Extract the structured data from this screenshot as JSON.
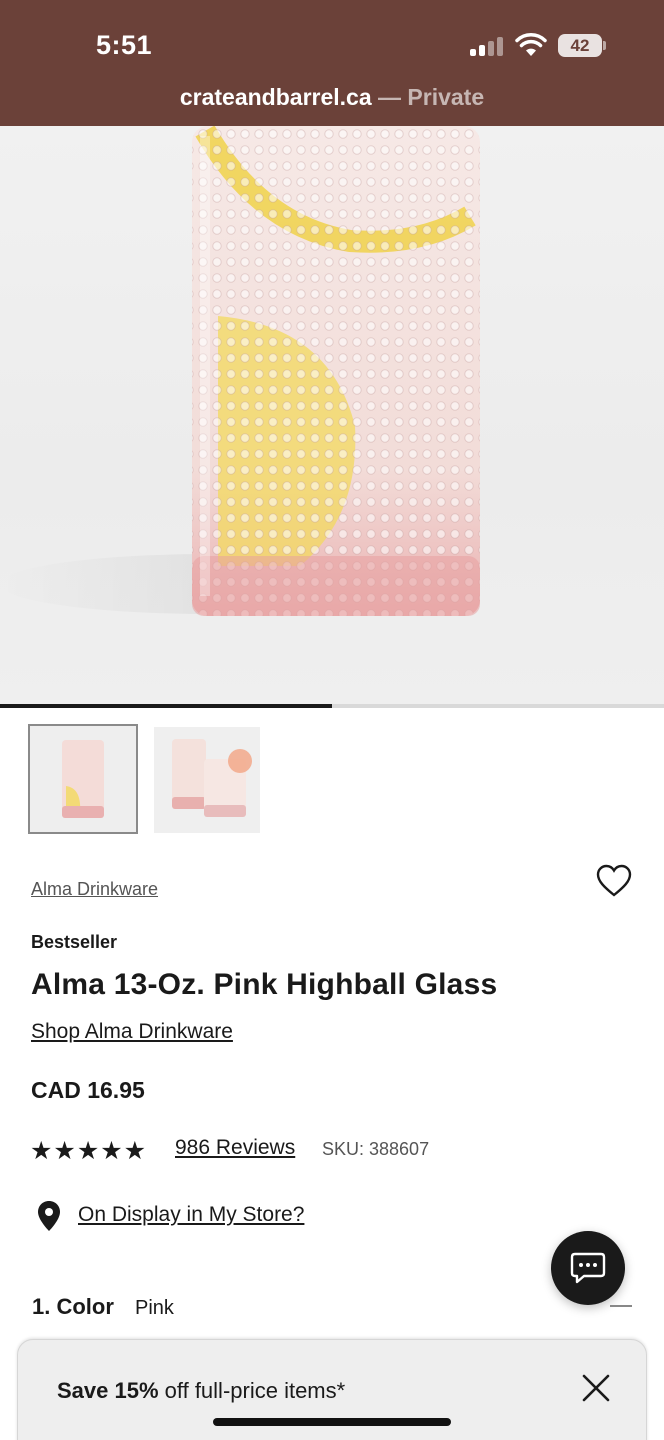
{
  "status_bar": {
    "time": "5:51",
    "battery": "42"
  },
  "browser": {
    "domain": "crateandbarrel.ca",
    "private_label": " — Private"
  },
  "gallery": {
    "progress": 0.5,
    "thumbnails": [
      "thumbnail-1",
      "thumbnail-2"
    ]
  },
  "product": {
    "collection_link": "Alma Drinkware",
    "badge": "Bestseller",
    "title": "Alma 13-Oz. Pink Highball Glass",
    "shop_link": "Shop Alma Drinkware",
    "price": "CAD 16.95",
    "rating": 5,
    "stars": "★★★★★",
    "reviews": "986 Reviews",
    "sku": "SKU: 388607",
    "display_link": "On Display in My Store?"
  },
  "options": {
    "color_step": "1. Color",
    "color_value": "Pink"
  },
  "promo": {
    "bold": "Save 15%",
    "rest": " off full-price items*"
  },
  "colors": {
    "topbar": "#6b4139",
    "text": "#1a1a1a"
  }
}
